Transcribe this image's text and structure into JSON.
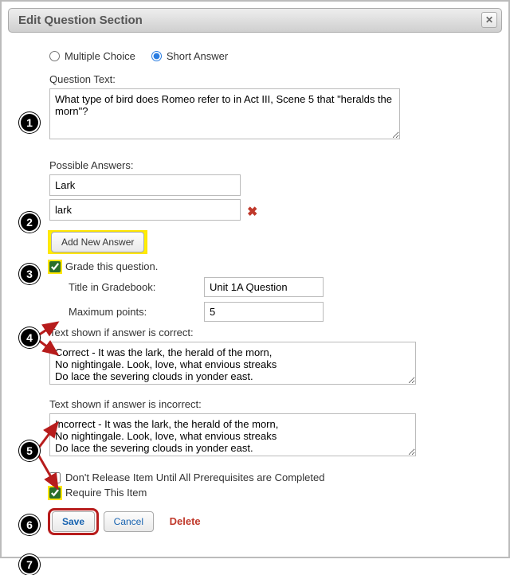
{
  "dialog": {
    "title": "Edit Question Section"
  },
  "type": {
    "multiple_choice_label": "Multiple Choice",
    "short_answer_label": "Short Answer",
    "selected": "short"
  },
  "question": {
    "label": "Question Text:",
    "text": "What type of bird does Romeo refer to in Act III, Scene 5 that \"heralds the morn\"?"
  },
  "answers": {
    "label": "Possible Answers:",
    "items": [
      {
        "value": "Lark"
      },
      {
        "value": "lark"
      }
    ],
    "add_label": "Add New Answer"
  },
  "grade": {
    "checkbox_label": "Grade this question.",
    "title_label": "Title in Gradebook:",
    "title_value": "Unit 1A Question",
    "points_label": "Maximum points:",
    "points_value": "5"
  },
  "feedback": {
    "correct_label": "Text shown if answer is correct:",
    "correct_text": "Correct - It was the lark, the herald of the morn,\nNo nightingale. Look, love, what envious streaks\nDo lace the severing clouds in yonder east.",
    "incorrect_label": "Text shown if answer is incorrect:",
    "incorrect_text": "Incorrect - It was the lark, the herald of the morn,\nNo nightingale. Look, love, what envious streaks\nDo lace the severing clouds in yonder east."
  },
  "release": {
    "prereq_label": "Don't Release Item Until All Prerequisites are Completed",
    "require_label": "Require This Item"
  },
  "actions": {
    "save": "Save",
    "cancel": "Cancel",
    "delete": "Delete"
  },
  "badges": [
    "1",
    "2",
    "3",
    "4",
    "5",
    "6",
    "7"
  ]
}
